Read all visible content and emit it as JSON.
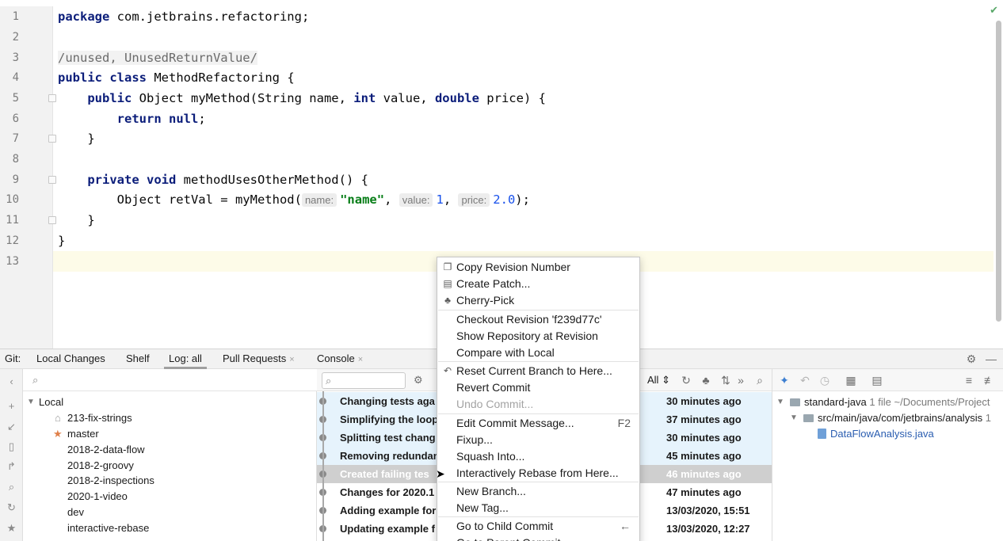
{
  "editor": {
    "lines": [
      {
        "n": "1"
      },
      {
        "n": "2"
      },
      {
        "n": "3"
      },
      {
        "n": "4"
      },
      {
        "n": "5"
      },
      {
        "n": "6"
      },
      {
        "n": "7"
      },
      {
        "n": "8"
      },
      {
        "n": "9"
      },
      {
        "n": "10"
      },
      {
        "n": "11"
      },
      {
        "n": "12"
      },
      {
        "n": "13"
      }
    ],
    "code": {
      "l1_kw": "package",
      "l1_rest": " com.jetbrains.refactoring;",
      "l3_ann": "/unused, UnusedReturnValue/",
      "l4_kw1": "public",
      "l4_kw2": "class",
      "l4_rest": " MethodRefactoring {",
      "l5_kw": "public",
      "l5_a": " Object myMethod(String name, ",
      "l5_kw2": "int",
      "l5_b": " value, ",
      "l5_kw3": "double",
      "l5_c": " price) {",
      "l6_kw": "return",
      "l6_kw2": "null",
      "l6_rest": ";",
      "l7": "}",
      "l9_kw1": "private",
      "l9_kw2": "void",
      "l9_rest": " methodUsesOtherMethod() {",
      "l10_a": "Object retVal = myMethod(",
      "l10_hint1": "name:",
      "l10_str": "\"name\"",
      "l10_sep1": ", ",
      "l10_hint2": "value:",
      "l10_num1": "1",
      "l10_sep2": ", ",
      "l10_hint3": "price:",
      "l10_num2": "2.0",
      "l10_end": ");",
      "l11": "}",
      "l12": "}"
    }
  },
  "toolwindow": {
    "prefix": "Git:",
    "tabs": [
      {
        "label": "Local Changes"
      },
      {
        "label": "Shelf"
      },
      {
        "label": "Log: all"
      },
      {
        "label": "Pull Requests",
        "close": "×"
      },
      {
        "label": "Console",
        "close": "×"
      }
    ]
  },
  "branches": {
    "group": "Local",
    "items": [
      {
        "label": "213-fix-strings"
      },
      {
        "label": "master"
      },
      {
        "label": "2018-2-data-flow"
      },
      {
        "label": "2018-2-groovy"
      },
      {
        "label": "2018-2-inspections"
      },
      {
        "label": "2020-1-video"
      },
      {
        "label": "dev"
      },
      {
        "label": "interactive-rebase"
      }
    ]
  },
  "log": {
    "filter_label": "All",
    "commits": [
      {
        "message": "Changing tests aga",
        "time": "30 minutes ago"
      },
      {
        "message": "Simplifying the loop",
        "time": "37 minutes ago"
      },
      {
        "message": "Splitting test chang",
        "time": "30 minutes ago"
      },
      {
        "message": "Removing redundan",
        "time": "45 minutes ago"
      },
      {
        "message": "Created failing tes",
        "time": "46 minutes ago"
      },
      {
        "message": "Changes for 2020.1",
        "time": "47 minutes ago"
      },
      {
        "message": "Adding example for",
        "time": "13/03/2020, 15:51"
      },
      {
        "message": "Updating example f",
        "time": "13/03/2020, 12:27"
      }
    ]
  },
  "details": {
    "project": "standard-java",
    "file_count": "1 file",
    "project_path": "~/Documents/Project",
    "folder": "src/main/java/com/jetbrains/analysis",
    "folder_count": "1",
    "file": "DataFlowAnalysis.java"
  },
  "context_menu": {
    "items": [
      {
        "label": "Copy Revision Number"
      },
      {
        "label": "Create Patch..."
      },
      {
        "label": "Cherry-Pick"
      },
      {
        "label": "Checkout Revision 'f239d77c'"
      },
      {
        "label": "Show Repository at Revision"
      },
      {
        "label": "Compare with Local"
      },
      {
        "label": "Reset Current Branch to Here..."
      },
      {
        "label": "Revert Commit"
      },
      {
        "label": "Undo Commit..."
      },
      {
        "label": "Edit Commit Message...",
        "shortcut": "F2"
      },
      {
        "label": "Fixup..."
      },
      {
        "label": "Squash Into..."
      },
      {
        "label": "Interactively Rebase from Here..."
      },
      {
        "label": "New Branch..."
      },
      {
        "label": "New Tag..."
      },
      {
        "label": "Go to Child Commit",
        "shortcut": "←"
      },
      {
        "label": "Go to Parent Commit",
        "shortcut": "→"
      }
    ]
  },
  "colors": {
    "keyword": "#0b1d7a",
    "string": "#067d17",
    "number": "#1750eb",
    "selection_row": "#cfcfcf",
    "highlight_row": "#e6f3fc",
    "caret_line": "#fdfbe8"
  },
  "icons": {
    "editor_status": "check-icon",
    "tool_settings": "gear-icon",
    "tool_minimize": "minimize-icon",
    "menu_copy": "copy-icon",
    "menu_patch": "patch-icon",
    "menu_cherry": "cherry-icon",
    "menu_reset": "reset-icon"
  }
}
